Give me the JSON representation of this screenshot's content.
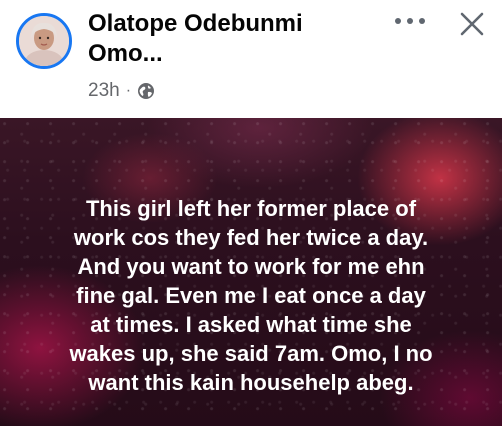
{
  "post": {
    "author_name": "Olatope Odebunmi",
    "subtitle": "Omo...",
    "time": "23h",
    "separator": "·",
    "audience_icon": "globe-icon",
    "more_icon": "more-horizontal-icon",
    "close_icon": "close-icon",
    "text_lines": [
      "This girl left her former place of",
      "work cos they fed her twice a day.",
      "And you want to work for me ehn",
      "fine gal. Even me I eat once a day",
      "at times. I asked what time she",
      "wakes up, she said 7am. Omo, I no",
      "want this kain househelp abeg."
    ]
  },
  "colors": {
    "accent": "#1877f2",
    "text_primary": "#050505",
    "text_secondary": "#65676b",
    "post_bg": "#2c0f1e"
  }
}
